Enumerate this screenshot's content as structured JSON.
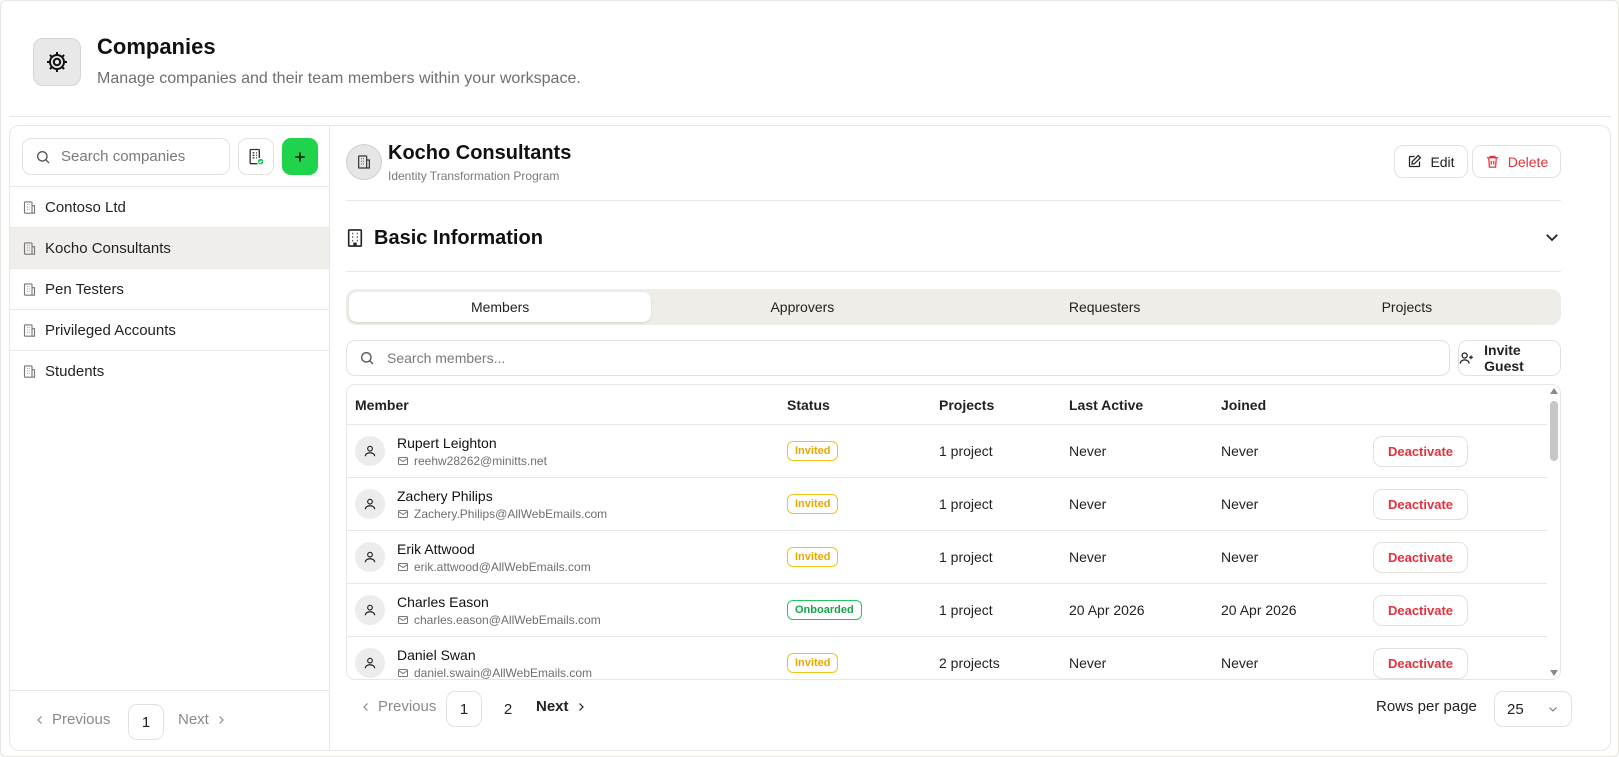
{
  "header": {
    "title": "Companies",
    "subtitle": "Manage companies and their team members within your workspace.",
    "icon": "gear-icon"
  },
  "sidebar": {
    "search_placeholder": "Search companies",
    "add_color": "#1fd44a",
    "companies": [
      {
        "label": "Contoso Ltd",
        "active": false
      },
      {
        "label": "Kocho Consultants",
        "active": true
      },
      {
        "label": "Pen Testers",
        "active": false
      },
      {
        "label": "Privileged Accounts",
        "active": false
      },
      {
        "label": "Students",
        "active": false
      }
    ],
    "pagination": {
      "prev": "Previous",
      "page": "1",
      "next": "Next"
    }
  },
  "company": {
    "name": "Kocho Consultants",
    "description": "Identity Transformation Program",
    "edit_label": "Edit",
    "delete_label": "Delete",
    "basic_info_title": "Basic Information"
  },
  "tabs": [
    {
      "label": "Members",
      "active": true
    },
    {
      "label": "Approvers",
      "active": false
    },
    {
      "label": "Requesters",
      "active": false
    },
    {
      "label": "Projects",
      "active": false
    }
  ],
  "members": {
    "search_placeholder": "Search members...",
    "invite_label": "Invite Guest",
    "columns": [
      "Member",
      "Status",
      "Projects",
      "Last Active",
      "Joined"
    ],
    "action_label": "Deactivate",
    "rows": [
      {
        "name": "Rupert Leighton",
        "email": "reehw28262@minitts.net",
        "status": "Invited",
        "projects": "1 project",
        "last_active": "Never",
        "joined": "Never"
      },
      {
        "name": "Zachery Philips",
        "email": "Zachery.Philips@AllWebEmails.com",
        "status": "Invited",
        "projects": "1 project",
        "last_active": "Never",
        "joined": "Never"
      },
      {
        "name": "Erik Attwood",
        "email": "erik.attwood@AllWebEmails.com",
        "status": "Invited",
        "projects": "1 project",
        "last_active": "Never",
        "joined": "Never"
      },
      {
        "name": "Charles Eason",
        "email": "charles.eason@AllWebEmails.com",
        "status": "Onboarded",
        "projects": "1 project",
        "last_active": "20 Apr 2026",
        "joined": "20 Apr 2026"
      },
      {
        "name": "Daniel Swan",
        "email": "daniel.swain@AllWebEmails.com",
        "status": "Invited",
        "projects": "2 projects",
        "last_active": "Never",
        "joined": "Never"
      }
    ],
    "pagination": {
      "prev": "Previous",
      "pages": [
        "1",
        "2"
      ],
      "current": "1",
      "next": "Next"
    },
    "rows_per_page_label": "Rows per page",
    "rows_per_page_value": "25"
  },
  "colors": {
    "accent_green": "#1fd44a",
    "danger": "#e5313d",
    "invited": "#e6a800",
    "onboarded": "#16a34a"
  }
}
